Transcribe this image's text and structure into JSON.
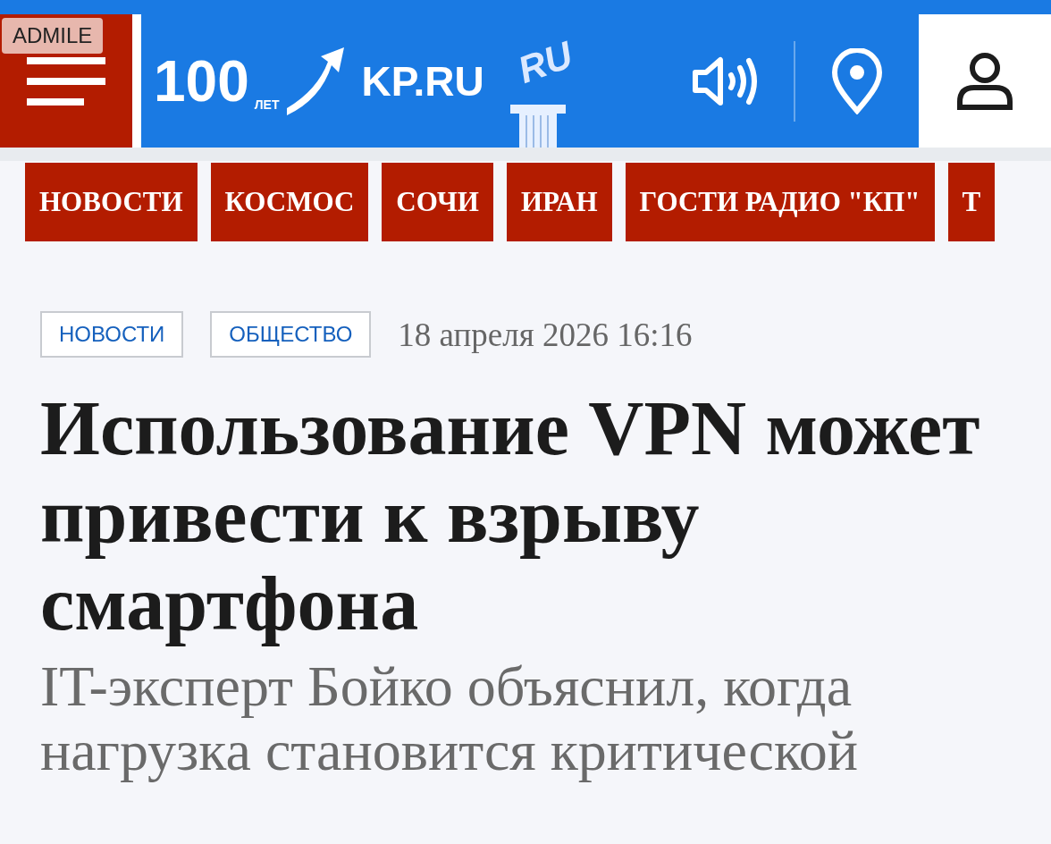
{
  "ad_badge": "ADMILE",
  "header": {
    "logo": {
      "anniversary": "100",
      "anniversary_unit": "ЛЕТ",
      "name": "KP.RU",
      "badge": "RU"
    }
  },
  "nav_tabs": [
    {
      "label": "НОВОСТИ"
    },
    {
      "label": "КОСМОС"
    },
    {
      "label": "СОЧИ"
    },
    {
      "label": "ИРАН"
    },
    {
      "label": "ГОСТИ РАДИО \"КП\""
    },
    {
      "label": "Т"
    }
  ],
  "article": {
    "tags": [
      "НОВОСТИ",
      "ОБЩЕСТВО"
    ],
    "date": "18 апреля 2026 16:16",
    "title": "Использование VPN может привести к взрыву смартфона",
    "subtitle": "IT-эксперт Бойко объяснил, когда нагрузка становится критической"
  }
}
